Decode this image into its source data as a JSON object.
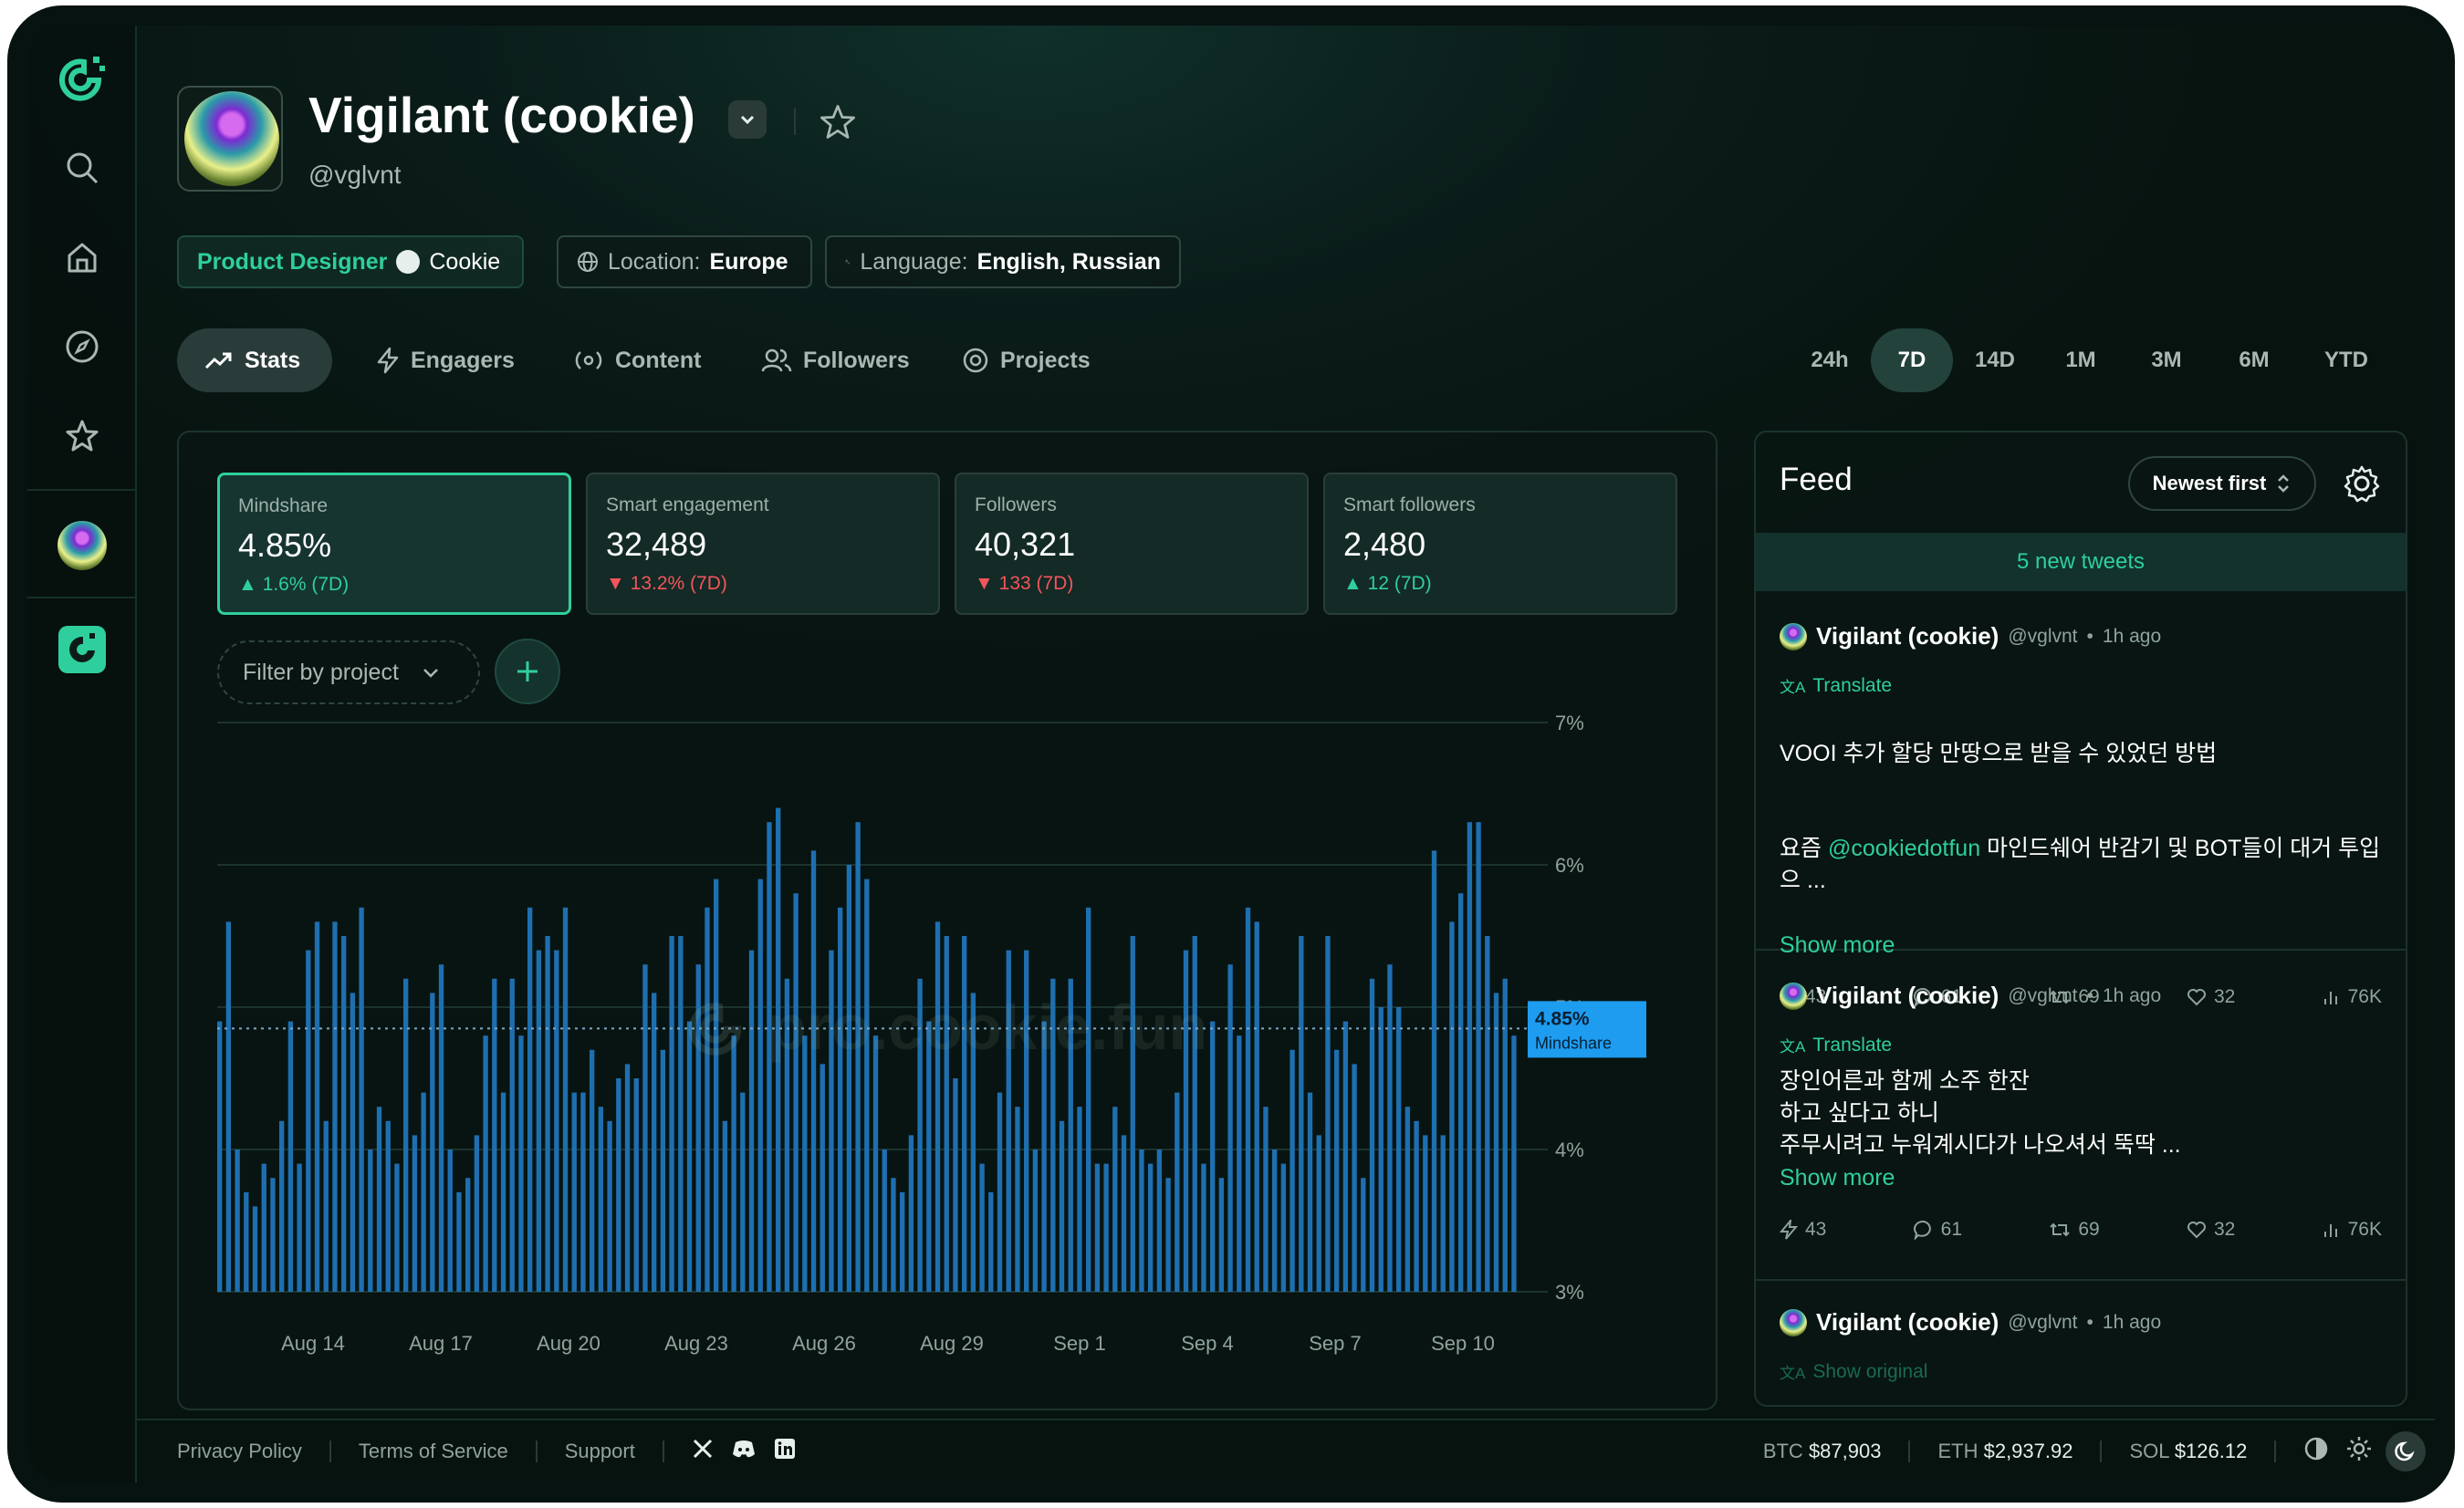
{
  "profile": {
    "name": "Vigilant (cookie)",
    "handle": "@vglvnt",
    "role": "Product Designer",
    "company": "Cookie",
    "location_label": "Location:",
    "location": "Europe",
    "language_label": "Language:",
    "language": "English, Russian"
  },
  "tabs": [
    {
      "label": "Stats",
      "icon": "trending-up-icon"
    },
    {
      "label": "Engagers",
      "icon": "lightning-icon"
    },
    {
      "label": "Content",
      "icon": "broadcast-icon"
    },
    {
      "label": "Followers",
      "icon": "users-icon"
    },
    {
      "label": "Projects",
      "icon": "target-icon"
    }
  ],
  "ranges": [
    "24h",
    "7D",
    "14D",
    "1M",
    "3M",
    "6M",
    "YTD"
  ],
  "active_range": "7D",
  "metrics": [
    {
      "label": "Mindshare",
      "value": "4.85%",
      "delta": "1.6% (7D)",
      "trend": "up"
    },
    {
      "label": "Smart engagement",
      "value": "32,489",
      "delta": "13.2% (7D)",
      "trend": "down"
    },
    {
      "label": "Followers",
      "value": "40,321",
      "delta": "133 (7D)",
      "trend": "down"
    },
    {
      "label": "Smart followers",
      "value": "2,480",
      "delta": "12 (7D)",
      "trend": "up"
    }
  ],
  "filter": {
    "placeholder": "Filter by project"
  },
  "watermark": "pro.cookie.fun",
  "chart_data": {
    "type": "bar",
    "ylim": [
      3,
      7
    ],
    "y_ticks": [
      "7%",
      "6%",
      "5%",
      "4%",
      "3%"
    ],
    "x_ticks": [
      "Aug 14",
      "Aug 17",
      "Aug 20",
      "Aug 23",
      "Aug 26",
      "Aug 29",
      "Sep 1",
      "Sep 4",
      "Sep 7",
      "Sep 10"
    ],
    "current": {
      "value": "4.85%",
      "label": "Mindshare"
    },
    "values": [
      4.9,
      5.6,
      4.0,
      3.7,
      3.6,
      3.9,
      3.8,
      4.2,
      4.9,
      3.9,
      5.4,
      5.6,
      4.2,
      5.6,
      5.5,
      5.1,
      5.7,
      4.0,
      4.3,
      4.2,
      3.9,
      5.2,
      4.1,
      4.4,
      5.1,
      5.3,
      4.0,
      3.7,
      3.8,
      4.1,
      4.8,
      5.2,
      4.4,
      5.2,
      4.8,
      5.7,
      5.4,
      5.5,
      5.4,
      5.7,
      4.4,
      4.4,
      4.7,
      4.3,
      4.2,
      4.5,
      4.6,
      4.5,
      5.3,
      5.1,
      4.7,
      5.5,
      5.5,
      4.9,
      5.3,
      5.7,
      5.9,
      4.2,
      4.8,
      4.4,
      5.4,
      5.9,
      6.3,
      6.4,
      5.2,
      5.8,
      4.8,
      6.1,
      4.6,
      5.4,
      5.7,
      6.0,
      6.3,
      5.9,
      4.8,
      4.0,
      3.8,
      3.7,
      4.1,
      5.2,
      4.9,
      5.6,
      5.5,
      4.5,
      5.5,
      5.1,
      3.9,
      3.7,
      4.4,
      5.4,
      4.3,
      5.4,
      4.0,
      4.9,
      5.2,
      4.2,
      5.2,
      4.3,
      5.7,
      3.9,
      3.9,
      4.3,
      4.1,
      5.5,
      4.0,
      3.9,
      4.0,
      3.8,
      4.4,
      5.4,
      5.5,
      3.9,
      4.9,
      3.8,
      5.3,
      4.8,
      5.7,
      5.6,
      4.3,
      4.0,
      3.9,
      4.7,
      5.5,
      4.4,
      4.1,
      5.5,
      4.7,
      4.9,
      4.6,
      3.8,
      5.2,
      5.0,
      5.3,
      5.0,
      4.3,
      4.2,
      4.1,
      6.1,
      4.1,
      5.6,
      5.8,
      6.3,
      6.3,
      5.5,
      5.1,
      5.2,
      4.8
    ]
  },
  "feed": {
    "title": "Feed",
    "sort_label": "Newest first",
    "new_tweets": "5 new tweets",
    "tweets": [
      {
        "name": "Vigilant (cookie)",
        "handle": "@vglvnt",
        "time": "1h ago",
        "action": "Translate",
        "line1": "VOOI 추가 할당 만땅으로 받을 수 있었던 방법",
        "line2_pre": "요즘 ",
        "mention": "@cookiedotfun",
        "line2_post": " 마인드쉐어 반감기 및 BOT들이 대거 투입으 ...",
        "more": "Show more",
        "stats": {
          "boosts": "43",
          "replies": "61",
          "retweets": "69",
          "likes": "32",
          "views": "76K"
        }
      },
      {
        "name": "Vigilant (cookie)",
        "handle": "@vglvnt",
        "time": "1h ago",
        "action": "Translate",
        "body": "장인어른과 함께 소주 한잔\n하고 싶다고 하니\n주무시려고 누워계시다가 나오셔서 뚝딱 ...",
        "more": "Show more",
        "stats": {
          "boosts": "43",
          "replies": "61",
          "retweets": "69",
          "likes": "32",
          "views": "76K"
        }
      },
      {
        "name": "Vigilant (cookie)",
        "handle": "@vglvnt",
        "time": "1h ago",
        "action": "Show original"
      }
    ]
  },
  "footer": {
    "links": [
      "Privacy Policy",
      "Terms of Service",
      "Support"
    ],
    "prices": [
      {
        "symbol": "BTC",
        "value": "$87,903"
      },
      {
        "symbol": "ETH",
        "value": "$2,937.92"
      },
      {
        "symbol": "SOL",
        "value": "$126.12"
      }
    ]
  },
  "colors": {
    "accent": "#2fcf9d",
    "bar": "#1e6fb0",
    "negative": "#f2555a",
    "highlight": "#1e9cf0"
  }
}
